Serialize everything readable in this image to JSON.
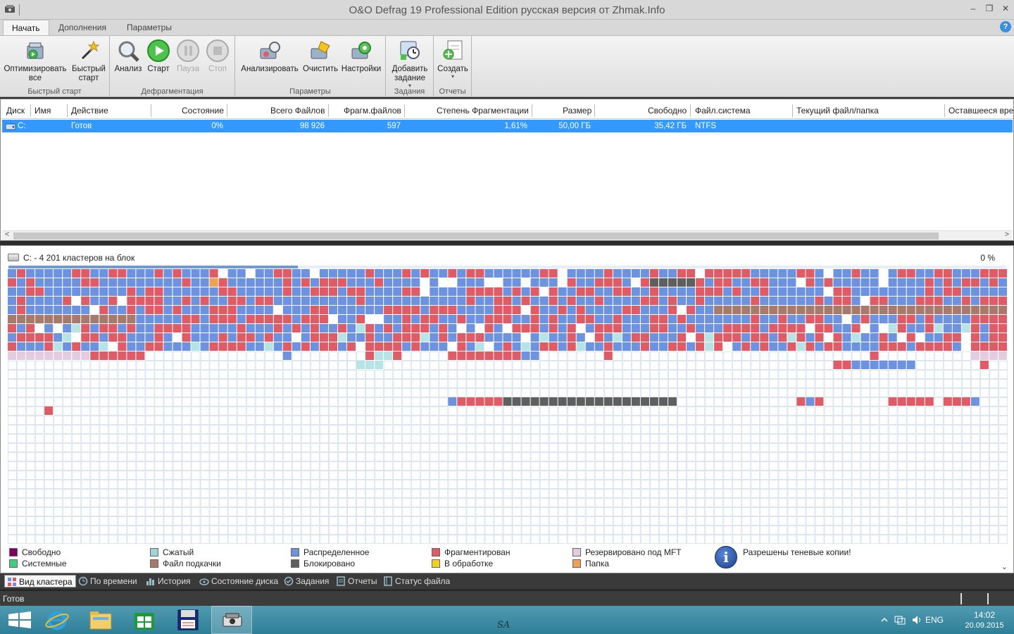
{
  "window": {
    "title": "O&O Defrag 19 Professional Edition русская версия от Zhmak.Info",
    "minimize": "‒",
    "restore": "❐",
    "close": "✕"
  },
  "tabs": [
    {
      "label": "Начать",
      "active": true
    },
    {
      "label": "Дополнения"
    },
    {
      "label": "Параметры"
    }
  ],
  "help": "?",
  "ribbon": {
    "groups": [
      {
        "label": "Быстрый старт",
        "buttons": [
          {
            "label": "Оптимизировать все",
            "icon": "optimize-all-icon"
          },
          {
            "label": "Быстрый старт",
            "icon": "quick-start-wand-icon"
          }
        ]
      },
      {
        "label": "Дефрагментация",
        "buttons": [
          {
            "label": "Анализ",
            "icon": "analyze-magnifier-icon"
          },
          {
            "label": "Старт",
            "icon": "start-play-icon"
          },
          {
            "label": "Пауза",
            "icon": "pause-icon",
            "disabled": true
          },
          {
            "label": "Стоп",
            "icon": "stop-icon",
            "disabled": true
          }
        ]
      },
      {
        "label": "Параметры",
        "buttons": [
          {
            "label": "Анализировать",
            "icon": "analyze-settings-icon"
          },
          {
            "label": "Очистить",
            "icon": "clean-icon"
          },
          {
            "label": "Настройки",
            "icon": "settings-gear-icon"
          }
        ]
      },
      {
        "label": "Задания",
        "buttons": [
          {
            "label": "Добавить задание",
            "icon": "add-job-icon",
            "dropdown": "▾"
          }
        ]
      },
      {
        "label": "Отчеты",
        "buttons": [
          {
            "label": "Создать",
            "icon": "create-report-icon",
            "dropdown": "▾"
          }
        ]
      }
    ]
  },
  "disk_table": {
    "columns": [
      "Диск",
      "Имя",
      "Действие",
      "Состояние",
      "Всего Файлов",
      "Фрагм.файлов",
      "Степень Фрагментации",
      "Размер",
      "Свободно",
      "Файл.система",
      "Текущий файл/папка",
      "Оставшееся время"
    ],
    "rows": [
      {
        "disk": "C:",
        "name": "",
        "action": "Готов",
        "state": "0%",
        "total_files": "98 926",
        "frag_files": "597",
        "frag_degree": "1,61%",
        "size": "50,00 ГБ",
        "free": "35,42 ГБ",
        "fs": "NTFS",
        "current": "",
        "remaining": ""
      }
    ],
    "scroll_left": "<",
    "scroll_right": ">"
  },
  "cluster_map": {
    "header": "C: - 4 201 кластеров на блок",
    "percent": "0 %",
    "progress_fraction": 0.29,
    "colors": {
      "free": "#ffffff",
      "compressed": "#b5e3e6",
      "distributed": "#6d93e0",
      "fragmented": "#df5c67",
      "mft": "#e3ccdf",
      "system": "#3fcf7f",
      "pagefile": "#a87a6c",
      "locked": "#5f5f5f",
      "processing": "#f0d020",
      "folder": "#f0a050",
      "grid": "#dbe6f2"
    }
  },
  "legend": [
    {
      "label": "Свободно",
      "color": "#800060"
    },
    {
      "label": "Системные",
      "color": "#3fcf7f"
    },
    {
      "label": "Сжатый",
      "color": "#9fd3d7"
    },
    {
      "label": "Файл подкачки",
      "color": "#a87a6c"
    },
    {
      "label": "Распределенное",
      "color": "#6d93e0"
    },
    {
      "label": "Блокировано",
      "color": "#5f5f5f"
    },
    {
      "label": "Фрагментирован",
      "color": "#df5c67"
    },
    {
      "label": "В обработке",
      "color": "#f0d020"
    },
    {
      "label": "Резервировано под MFT",
      "color": "#e3ccdf"
    },
    {
      "label": "Папка",
      "color": "#f0a050"
    }
  ],
  "info": {
    "icon": "i",
    "text": "Разрешены теневые копии!"
  },
  "map_scroll_down": "⌄",
  "view_tabs": [
    {
      "label": "Вид кластера",
      "active": true,
      "icon": "cluster-view-icon"
    },
    {
      "label": "По времени",
      "icon": "time-view-icon"
    },
    {
      "label": "История",
      "icon": "history-chart-icon"
    },
    {
      "label": "Состояние диска",
      "icon": "disk-status-icon"
    },
    {
      "label": "Задания",
      "icon": "jobs-icon"
    },
    {
      "label": "Отчеты",
      "icon": "reports-icon"
    },
    {
      "label": "Статус файла",
      "icon": "file-status-icon"
    }
  ],
  "status": "Готов",
  "taskbar": {
    "signature": "SA",
    "lang": "ENG",
    "time": "14:02",
    "date": "20.09.2015"
  }
}
